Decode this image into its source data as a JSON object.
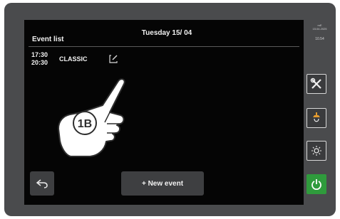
{
  "header": {
    "date": "Tuesday 15/ 04",
    "list_title": "Event list"
  },
  "events": [
    {
      "start": "17:30",
      "end": "20:30",
      "name": "CLASSIC",
      "icon": "edit-icon"
    }
  ],
  "footer": {
    "back_icon": "back-arrow-icon",
    "new_event_label": "+ New event"
  },
  "side_panel": {
    "date_lines": [
      "mE",
      "15.04.2025"
    ],
    "time": "10.54",
    "buttons": [
      {
        "icon": "settings-tools-icon"
      },
      {
        "icon": "lamp-icon"
      },
      {
        "icon": "light-icon"
      },
      {
        "icon": "power-icon"
      }
    ]
  },
  "callout": {
    "label": "1B",
    "icon": "hand-pointer-icon"
  },
  "colors": {
    "screen_background": "#050505",
    "device_frame": "#4a4b4d",
    "button_dark": "#3e3f41",
    "power_green": "#2f9b3c"
  }
}
